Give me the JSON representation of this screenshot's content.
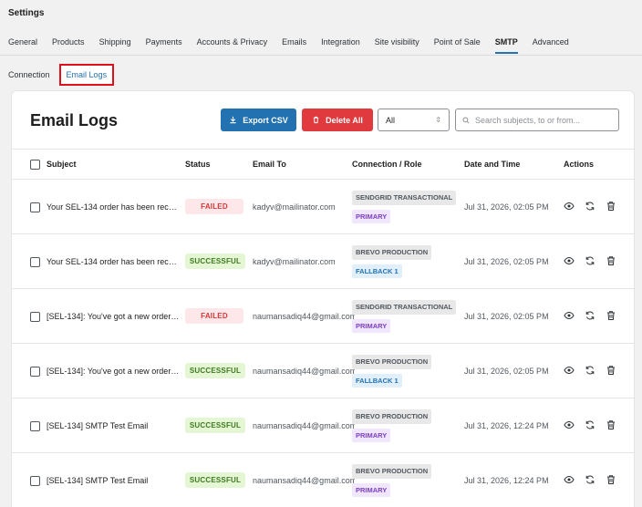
{
  "page": {
    "title": "Settings"
  },
  "tabs": [
    {
      "label": "General"
    },
    {
      "label": "Products"
    },
    {
      "label": "Shipping"
    },
    {
      "label": "Payments"
    },
    {
      "label": "Accounts & Privacy"
    },
    {
      "label": "Emails"
    },
    {
      "label": "Integration"
    },
    {
      "label": "Site visibility"
    },
    {
      "label": "Point of Sale"
    },
    {
      "label": "SMTP",
      "active": true
    },
    {
      "label": "Advanced"
    }
  ],
  "subtabs": [
    {
      "label": "Connection"
    },
    {
      "label": "Email Logs",
      "active": true
    }
  ],
  "card": {
    "title": "Email Logs",
    "export_label": "Export CSV",
    "delete_label": "Delete All",
    "filter_value": "All",
    "search_placeholder": "Search subjects, to or from..."
  },
  "table": {
    "columns": {
      "subject": "Subject",
      "status": "Status",
      "email_to": "Email To",
      "connection": "Connection / Role",
      "date": "Date and Time",
      "actions": "Actions"
    },
    "rows": [
      {
        "subject": "Your SEL-134 order has been rece...",
        "status": "FAILED",
        "status_type": "failed",
        "email": "kadyv@mailinator.com",
        "connection": "SENDGRID TRANSACTIONAL",
        "role": "PRIMARY",
        "role_type": "primary",
        "date": "Jul 31, 2026, 02:05 PM"
      },
      {
        "subject": "Your SEL-134 order has been rece...",
        "status": "SUCCESSFUL",
        "status_type": "success",
        "email": "kadyv@mailinator.com",
        "connection": "BREVO PRODUCTION",
        "role": "FALLBACK 1",
        "role_type": "fallback",
        "date": "Jul 31, 2026, 02:05 PM"
      },
      {
        "subject": "[SEL-134]: You've got a new order:...",
        "status": "FAILED",
        "status_type": "failed",
        "email": "naumansadiq44@gmail.com",
        "connection": "SENDGRID TRANSACTIONAL",
        "role": "PRIMARY",
        "role_type": "primary",
        "date": "Jul 31, 2026, 02:05 PM"
      },
      {
        "subject": "[SEL-134]: You've got a new order:...",
        "status": "SUCCESSFUL",
        "status_type": "success",
        "email": "naumansadiq44@gmail.com",
        "connection": "BREVO PRODUCTION",
        "role": "FALLBACK 1",
        "role_type": "fallback",
        "date": "Jul 31, 2026, 02:05 PM"
      },
      {
        "subject": "[SEL-134] SMTP Test Email",
        "status": "SUCCESSFUL",
        "status_type": "success",
        "email": "naumansadiq44@gmail.com",
        "connection": "BREVO PRODUCTION",
        "role": "PRIMARY",
        "role_type": "primary",
        "date": "Jul 31, 2026, 12:24 PM"
      },
      {
        "subject": "[SEL-134] SMTP Test Email",
        "status": "SUCCESSFUL",
        "status_type": "success",
        "email": "naumansadiq44@gmail.com",
        "connection": "BREVO PRODUCTION",
        "role": "PRIMARY",
        "role_type": "primary",
        "date": "Jul 31, 2026, 12:24 PM"
      }
    ]
  },
  "icons": {
    "view": "eye-icon",
    "resend": "refresh-icon",
    "delete": "trash-icon"
  },
  "colors": {
    "accent": "#2271b1",
    "danger": "#e0393e",
    "highlight_border": "#e0101a"
  }
}
